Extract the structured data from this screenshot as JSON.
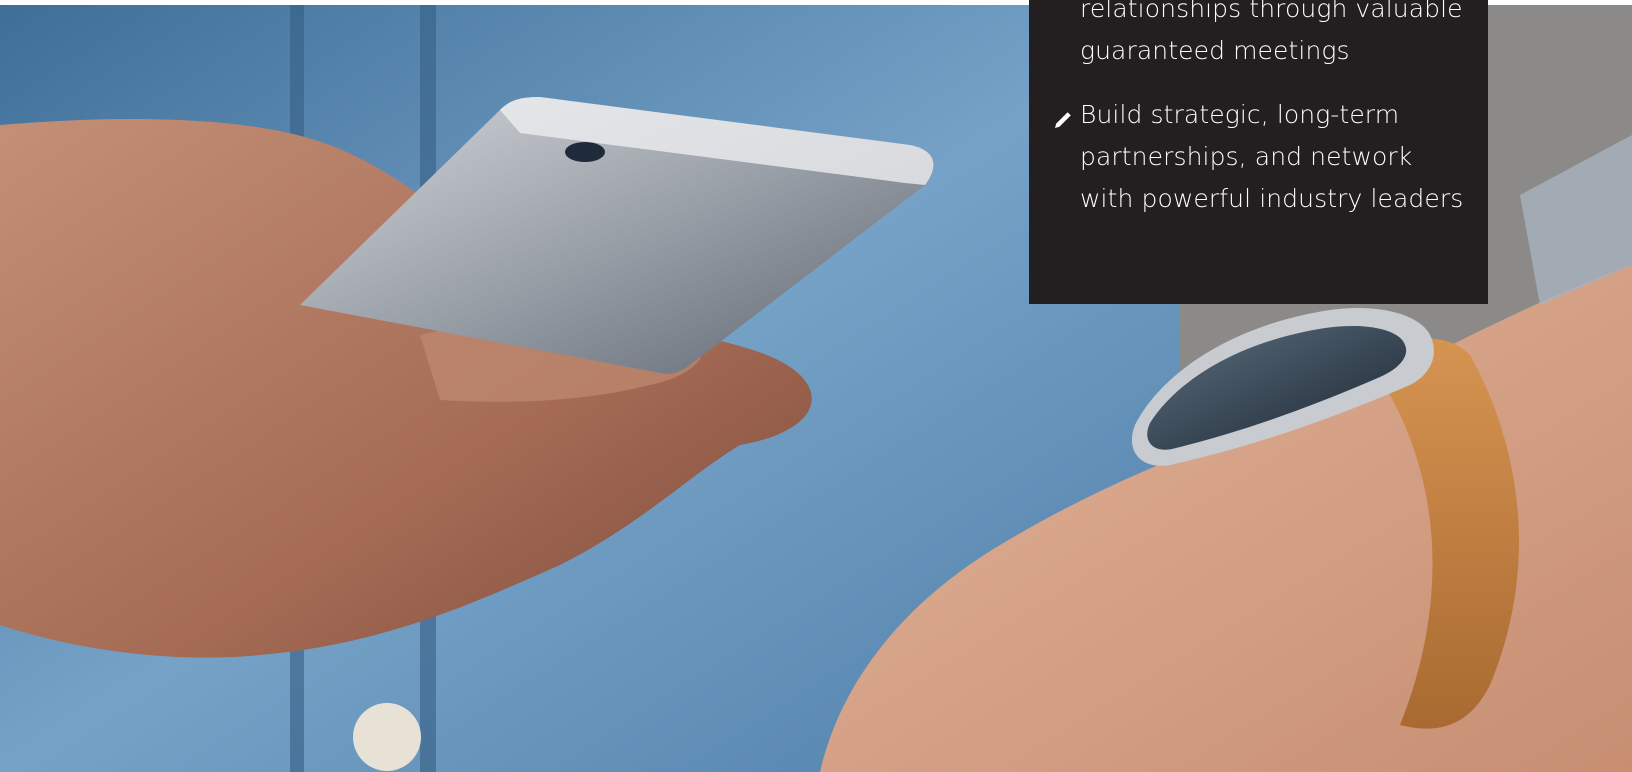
{
  "hero": {
    "image_subject": "Hands holding a smartphone and wearing a smartwatch"
  },
  "benefits_card": {
    "items": [
      {
        "icon": "pencil-icon",
        "text": "Jump-start valuable business relationships through valuable guaranteed meetings"
      },
      {
        "icon": "pencil-icon",
        "text": "Build strategic, long-term partnerships, and network with powerful industry leaders"
      }
    ]
  },
  "colors": {
    "card_background": "#231f20",
    "card_text": "#ffffff"
  }
}
